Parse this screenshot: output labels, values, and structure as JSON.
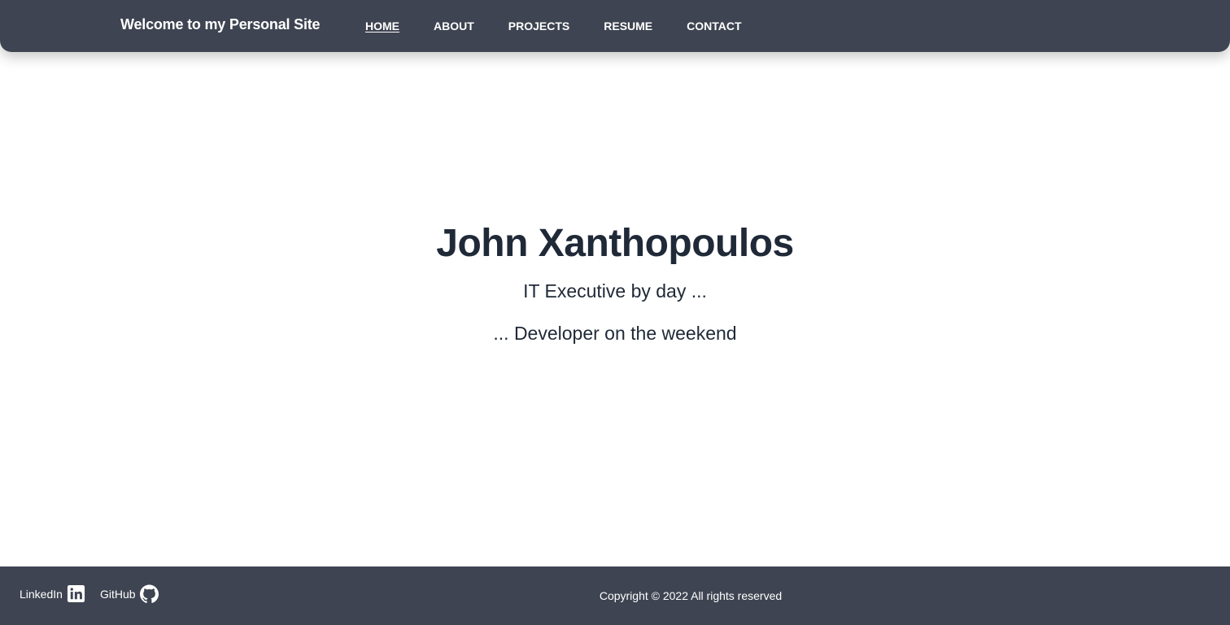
{
  "header": {
    "site_title": "Welcome to my Personal Site",
    "nav": [
      {
        "label": "HOME",
        "active": true
      },
      {
        "label": "ABOUT",
        "active": false
      },
      {
        "label": "PROJECTS",
        "active": false
      },
      {
        "label": "RESUME",
        "active": false
      },
      {
        "label": "CONTACT",
        "active": false
      }
    ]
  },
  "hero": {
    "name": "John Xanthopoulos",
    "line1": "IT Executive by day ...",
    "line2": "... Developer on the weekend"
  },
  "footer": {
    "social": [
      {
        "label": "LinkedIn",
        "icon": "linkedin-icon"
      },
      {
        "label": "GitHub",
        "icon": "github-icon"
      }
    ],
    "copyright": "Copyright © 2022 All rights reserved"
  },
  "colors": {
    "bar_background": "#3e4451",
    "bar_text": "#ffffff",
    "page_background": "#ffffff",
    "heading_text": "#1f2937"
  }
}
